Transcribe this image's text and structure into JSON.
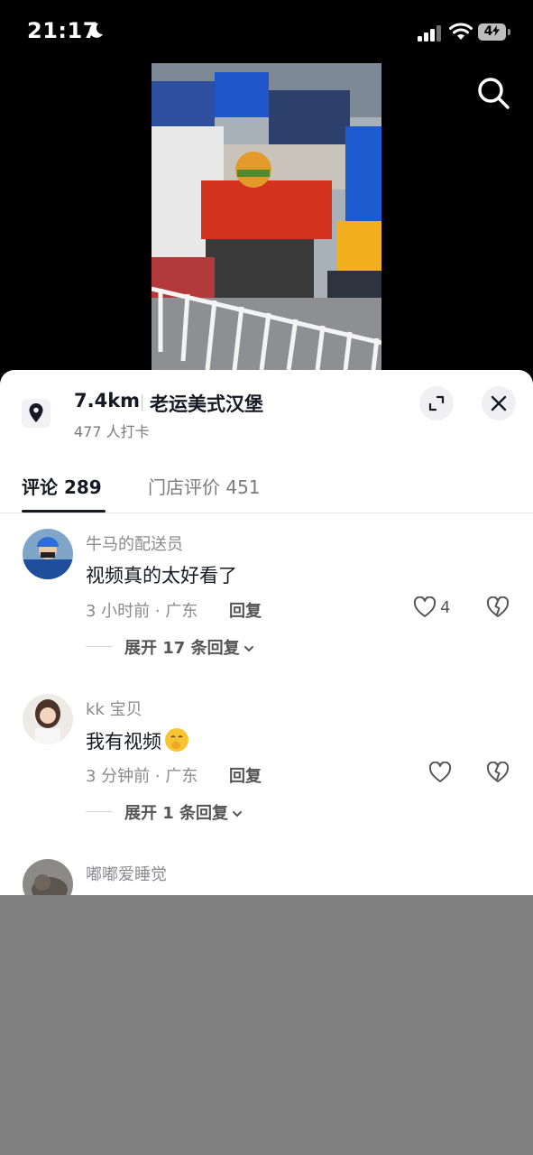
{
  "status_bar": {
    "time": "21:17",
    "battery_level": "4",
    "icons": [
      "moon-icon",
      "signal-icon",
      "wifi-icon",
      "battery-icon"
    ]
  },
  "video": {
    "icons": [
      "search-icon"
    ]
  },
  "location": {
    "distance": "7.4km",
    "name": "老运美式汉堡",
    "checkins": "477 人打卡",
    "icons": [
      "location-pin-icon",
      "expand-icon",
      "close-icon"
    ]
  },
  "tabs": [
    {
      "label": "评论 289"
    },
    {
      "label": "门店评价 451"
    }
  ],
  "comments": [
    {
      "user": "牛马的配送员",
      "text": "视频真的太好看了",
      "meta": "3 小时前 · 广东",
      "reply": "回复",
      "likes": "4",
      "expand": "展开 17 条回复"
    },
    {
      "user": "kk 宝贝",
      "text": "我有视频",
      "emoji": "shushing-face",
      "meta": "3 分钟前 · 广东",
      "reply": "回复",
      "likes": "",
      "expand": "展开 1 条回复"
    },
    {
      "user": "嘟嘟爱睡觉",
      "text": ""
    }
  ],
  "colors": {
    "background": "#000000",
    "sheet": "#ffffff",
    "primary_text": "#161823",
    "secondary_text": "#8a8a90",
    "overlay": "#808080"
  }
}
